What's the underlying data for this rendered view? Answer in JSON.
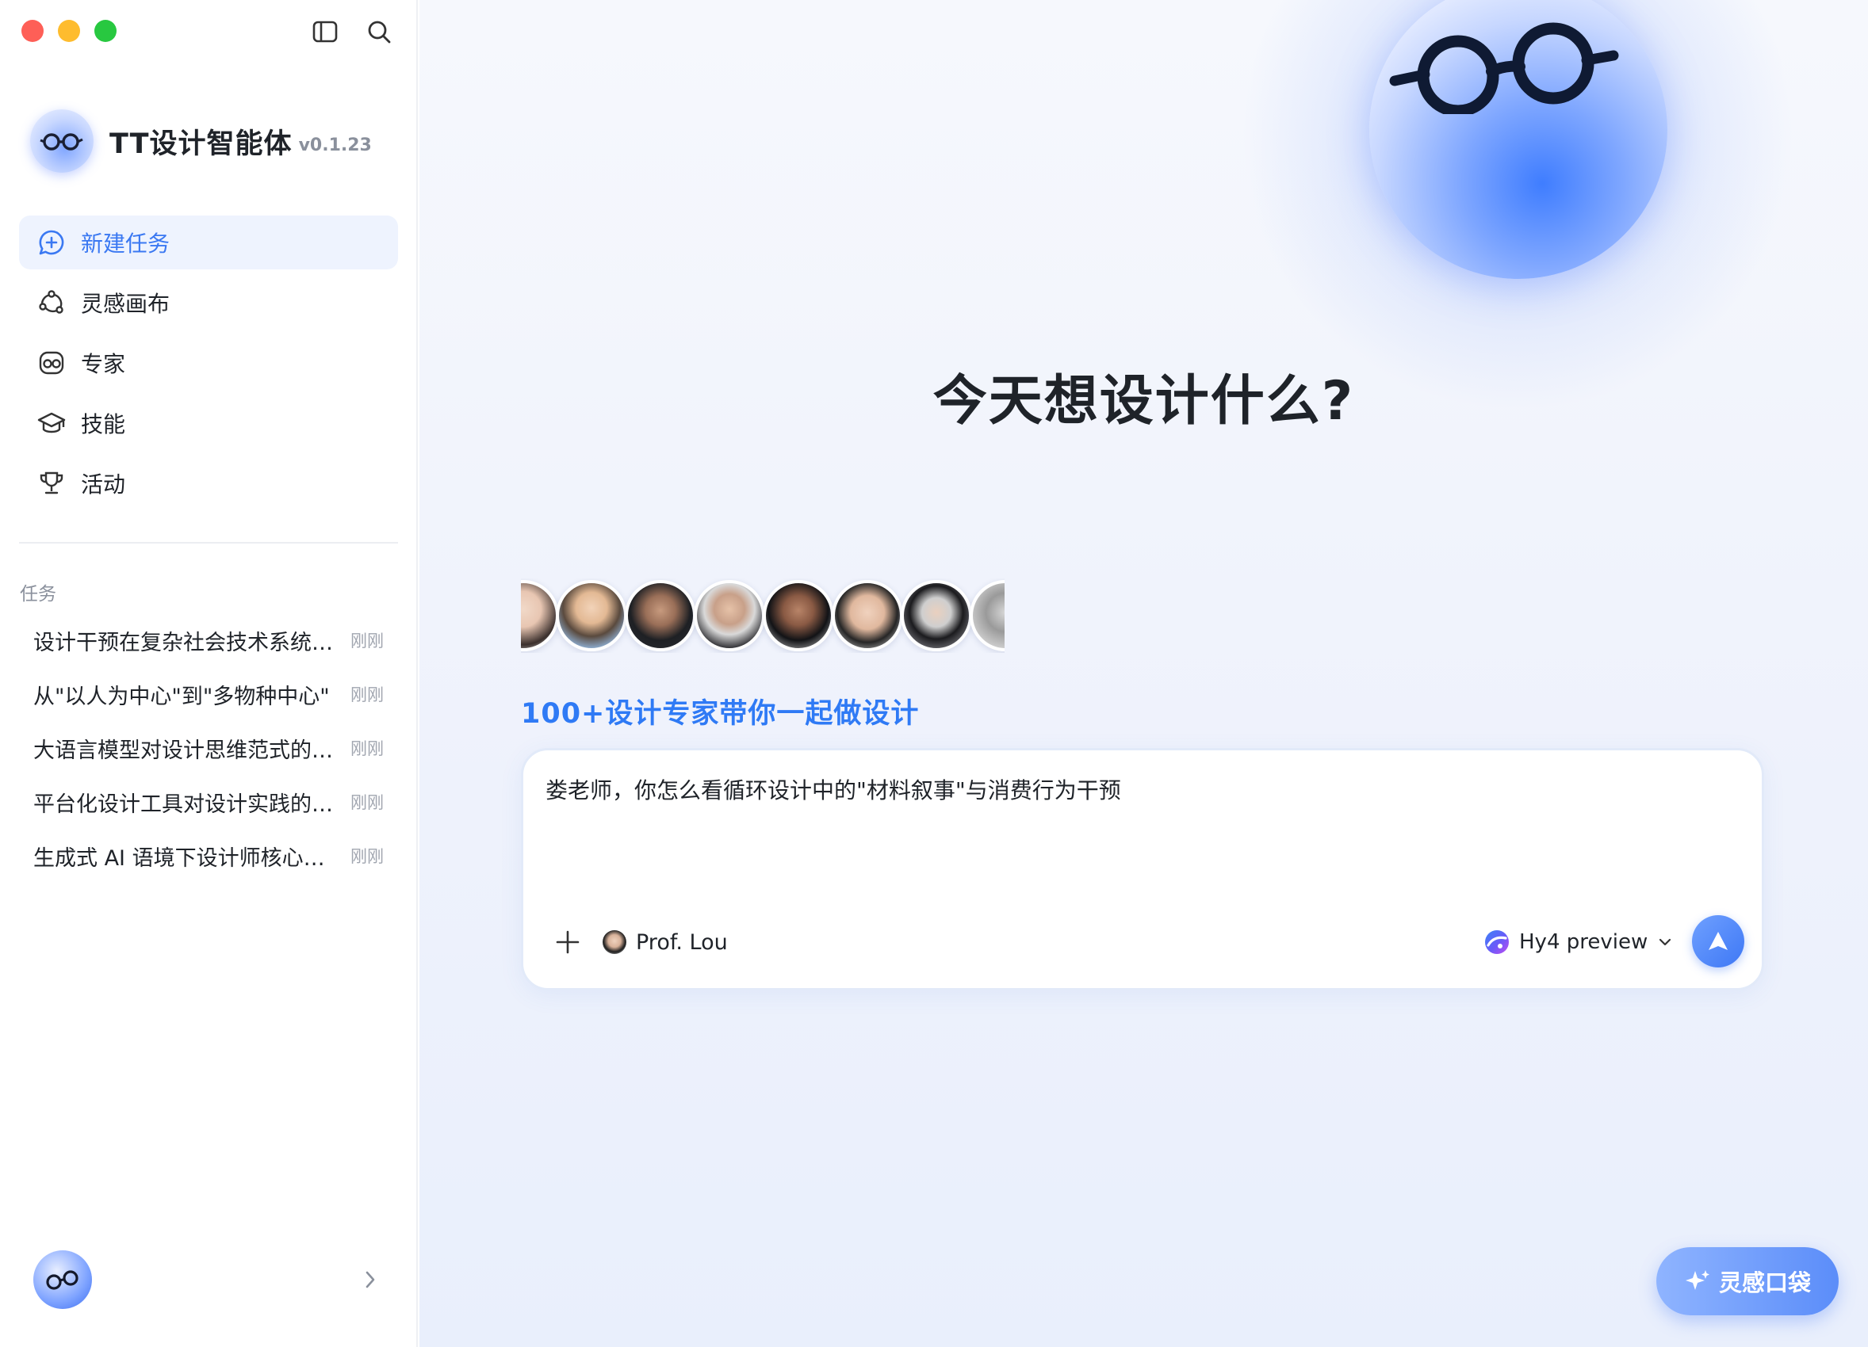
{
  "app": {
    "name": "TT设计智能体",
    "version": "v0.1.23"
  },
  "nav": {
    "items": [
      {
        "label": "新建任务",
        "icon": "chat-plus-icon",
        "active": true
      },
      {
        "label": "灵感画布",
        "icon": "canvas-nodes-icon",
        "active": false
      },
      {
        "label": "专家",
        "icon": "expert-glasses-icon",
        "active": false
      },
      {
        "label": "技能",
        "icon": "graduation-cap-icon",
        "active": false
      },
      {
        "label": "活动",
        "icon": "trophy-icon",
        "active": false
      }
    ]
  },
  "tasks": {
    "title": "任务",
    "items": [
      {
        "name": "设计干预在复杂社会技术系统中的作用",
        "time": "刚刚"
      },
      {
        "name": "从\"以人为中心\"到\"多物种中心\"",
        "time": "刚刚"
      },
      {
        "name": "大语言模型对设计思维范式的影响",
        "time": "刚刚"
      },
      {
        "name": "平台化设计工具对设计实践的影响",
        "time": "刚刚"
      },
      {
        "name": "生成式 AI 语境下设计师核心能力",
        "time": "刚刚"
      }
    ]
  },
  "main": {
    "headline": "今天想设计什么?",
    "tagline": "100+设计专家带你一起做设计",
    "chat": {
      "input_value": "娄老师，你怎么看循环设计中的\"材料叙事\"与消费行为干预",
      "expert_label": "Prof. Lou",
      "model_label": "Hy4 preview"
    },
    "pocket_label": "灵感口袋"
  },
  "colors": {
    "accent": "#3a78f2",
    "tagline": "#2f7af5",
    "active_nav_bg": "#eef3fe"
  }
}
